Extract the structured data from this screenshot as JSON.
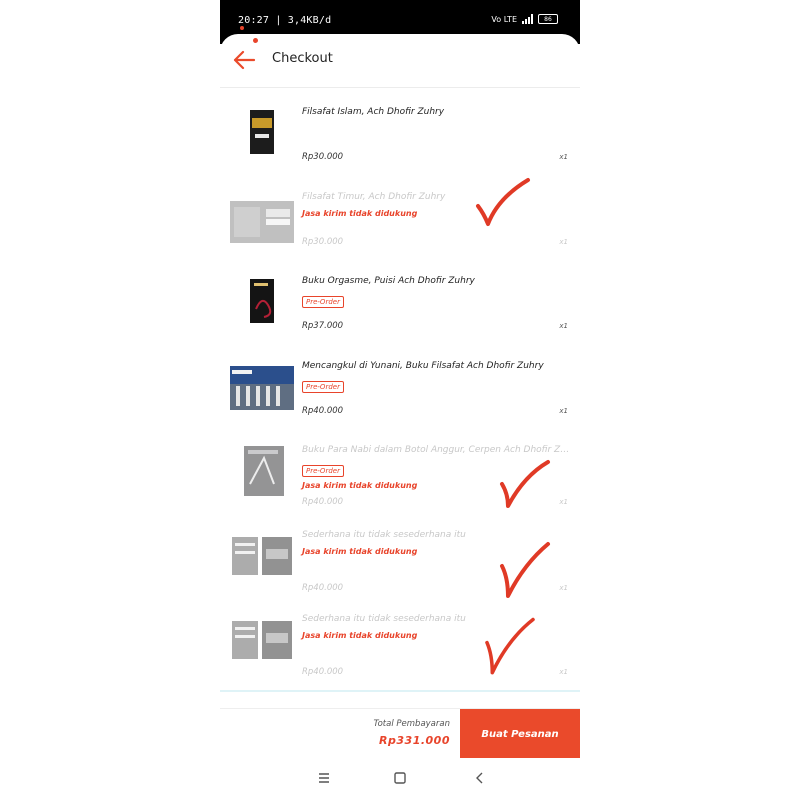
{
  "status_bar": {
    "time": "20:27 | 3,4KB/d",
    "network": "Vo LTE",
    "battery": "86"
  },
  "header": {
    "title": "Checkout",
    "back_icon": "arrow-left-icon"
  },
  "items": [
    {
      "name": "Filsafat Islam, Ach Dhofir Zuhry",
      "badge": "",
      "warning": "",
      "price": "Rp30.000",
      "qty": "x1",
      "disabled": false
    },
    {
      "name": "Filsafat Timur, Ach Dhofir Zuhry",
      "badge": "",
      "warning": "Jasa kirim tidak didukung",
      "price": "Rp30.000",
      "qty": "x1",
      "disabled": true
    },
    {
      "name": "Buku Orgasme, Puisi Ach Dhofir Zuhry",
      "badge": "Pre-Order",
      "warning": "",
      "price": "Rp37.000",
      "qty": "x1",
      "disabled": false
    },
    {
      "name": "Mencangkul di Yunani, Buku Filsafat Ach Dhofir Zuhry",
      "badge": "Pre-Order",
      "warning": "",
      "price": "Rp40.000",
      "qty": "x1",
      "disabled": false
    },
    {
      "name": "Buku Para Nabi dalam Botol Anggur, Cerpen Ach Dhofir Zu...",
      "badge": "Pre-Order",
      "warning": "Jasa kirim tidak didukung",
      "price": "Rp40.000",
      "qty": "x1",
      "disabled": true
    },
    {
      "name": "Sederhana itu tidak sesederhana itu",
      "badge": "",
      "warning": "Jasa kirim tidak didukung",
      "price": "Rp40.000",
      "qty": "x1",
      "disabled": true
    },
    {
      "name": "Sederhana itu tidak sesederhana itu",
      "badge": "",
      "warning": "Jasa kirim tidak didukung",
      "price": "Rp40.000",
      "qty": "x1",
      "disabled": true
    }
  ],
  "footer": {
    "total_label": "Total Pembayaran",
    "total_value": "Rp331.000",
    "order_button": "Buat Pesanan"
  },
  "colors": {
    "accent": "#ea4a2b",
    "check_marks": "#e03a26"
  }
}
